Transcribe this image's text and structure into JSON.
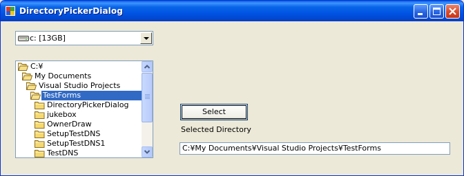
{
  "window": {
    "title": "DirectoryPickerDialog"
  },
  "drive_combo": {
    "value": "c: [13GB]",
    "icon": "drive-icon"
  },
  "tree": {
    "items": [
      {
        "label": "C:¥",
        "level": 0,
        "selected": false,
        "open": true
      },
      {
        "label": "My Documents",
        "level": 1,
        "selected": false,
        "open": true
      },
      {
        "label": "Visual Studio Projects",
        "level": 2,
        "selected": false,
        "open": true
      },
      {
        "label": "TestForms",
        "level": 3,
        "selected": true,
        "open": true
      },
      {
        "label": "DirectoryPickerDialog",
        "level": 4,
        "selected": false,
        "open": false
      },
      {
        "label": "jukebox",
        "level": 4,
        "selected": false,
        "open": false
      },
      {
        "label": "OwnerDraw",
        "level": 4,
        "selected": false,
        "open": false
      },
      {
        "label": "SetupTestDNS",
        "level": 4,
        "selected": false,
        "open": false
      },
      {
        "label": "SetupTestDNS1",
        "level": 4,
        "selected": false,
        "open": false
      },
      {
        "label": "TestDNS",
        "level": 4,
        "selected": false,
        "open": false
      }
    ]
  },
  "select_button": {
    "label": "Select"
  },
  "selected_directory": {
    "label": "Selected Directory",
    "value": "C:¥My Documents¥Visual Studio Projects¥TestForms"
  },
  "colors": {
    "selection": "#316AC5",
    "titlebar": "#0054E3",
    "face": "#ECE9D8"
  }
}
